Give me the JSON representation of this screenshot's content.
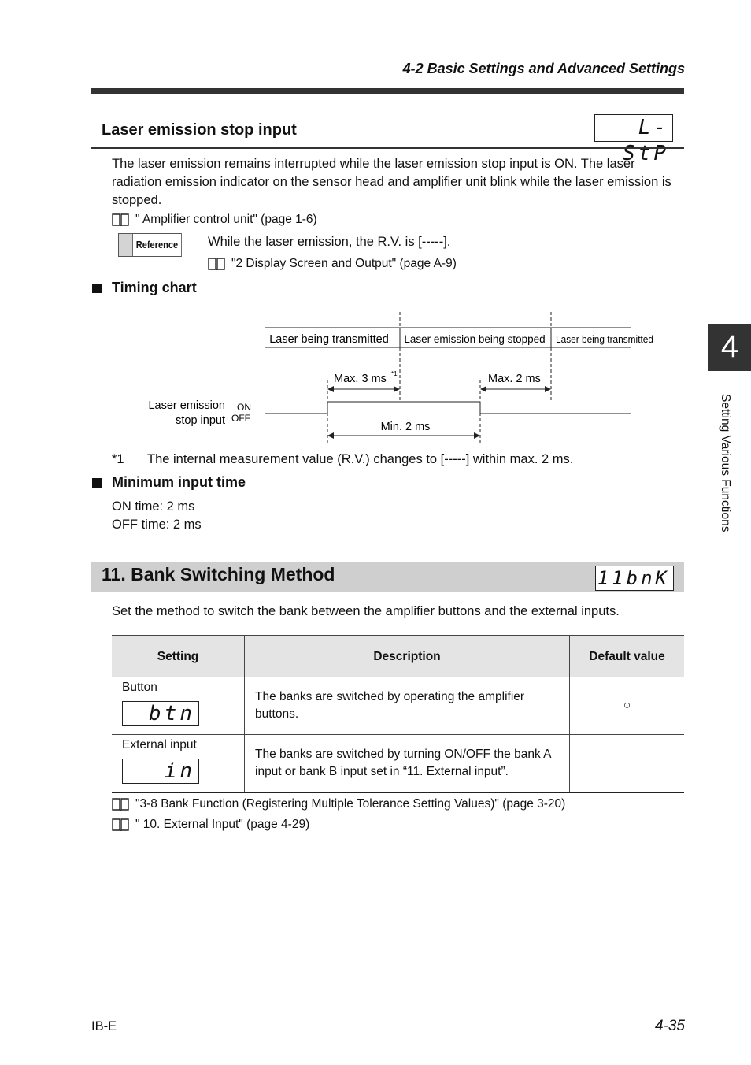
{
  "header": {
    "section_title": "4-2  Basic Settings and Advanced Settings"
  },
  "laser_stop": {
    "title": "Laser emission stop input",
    "lcd": "L-StP",
    "paragraph": "The laser emission remains interrupted while the laser emission stop input is ON. The laser radiation emission indicator on the sensor head and amplifier unit blink while the laser emission is stopped.",
    "ref_link": "\" Amplifier control unit\" (page 1-6)",
    "reference_badge": "Reference",
    "reference_note": "While the laser emission, the R.V. is [-----].",
    "reference_link": "\"2 Display Screen and Output\" (page A-9)",
    "timing_heading": "Timing chart",
    "timing": {
      "phases": [
        "Laser being transmitted",
        "Laser emission being stopped",
        "Laser being transmitted"
      ],
      "signal_label_line1": "Laser emission",
      "signal_label_line2": "stop input",
      "on_label": "ON",
      "off_label": "OFF",
      "max_on_delay": "Max. 3 ms",
      "max_on_delay_note": "*1",
      "max_off_delay": "Max. 2 ms",
      "min_pulse": "Min. 2 ms"
    },
    "footnote_num": "*1",
    "footnote_text": "The internal measurement value (R.V.) changes to [-----] within max. 2 ms.",
    "min_input_heading": "Minimum input time",
    "on_time": "ON time: 2 ms",
    "off_time": "OFF time: 2 ms"
  },
  "bank": {
    "title": "11. Bank Switching Method",
    "lcd": "11bnK",
    "intro": "Set the method to switch the bank between the amplifier buttons and the external inputs.",
    "table": {
      "headers": [
        "Setting",
        "Description",
        "Default value"
      ],
      "rows": [
        {
          "setting": "Button",
          "lcd": "btn",
          "description": "The banks are switched by operating the amplifier buttons.",
          "default": "○"
        },
        {
          "setting": "External input",
          "lcd": "in",
          "description": "The banks are switched by turning ON/OFF the bank A input or bank B input set in “11. External input”.",
          "default": ""
        }
      ]
    },
    "refs": [
      "\"3-8 Bank Function (Registering Multiple Tolerance Setting Values)\" (page 3-20)",
      "\" 10. External Input\" (page 4-29)"
    ]
  },
  "side_tab": {
    "chapter": "4",
    "label": "Setting Various Functions"
  },
  "footer": {
    "left": "IB-E",
    "page": "4-35"
  }
}
